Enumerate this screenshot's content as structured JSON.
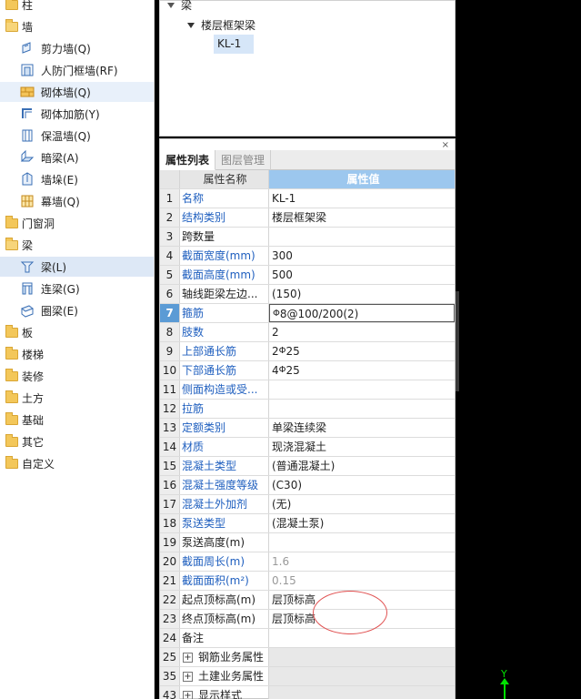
{
  "left_tree": [
    {
      "label": "柱",
      "kind": "folder"
    },
    {
      "label": "墙",
      "kind": "folder-open"
    },
    {
      "label": "剪力墙(Q)",
      "kind": "sub",
      "icon": "shear-wall-icon"
    },
    {
      "label": "人防门框墙(RF)",
      "kind": "sub",
      "icon": "door-frame-wall-icon"
    },
    {
      "label": "砌体墙(Q)",
      "kind": "sub",
      "icon": "masonry-wall-icon",
      "state": "hover"
    },
    {
      "label": "砌体加筋(Y)",
      "kind": "sub",
      "icon": "masonry-rebar-icon"
    },
    {
      "label": "保温墙(Q)",
      "kind": "sub",
      "icon": "insulation-wall-icon"
    },
    {
      "label": "暗梁(A)",
      "kind": "sub",
      "icon": "hidden-beam-icon"
    },
    {
      "label": "墙垛(E)",
      "kind": "sub",
      "icon": "wall-pier-icon"
    },
    {
      "label": "幕墙(Q)",
      "kind": "sub",
      "icon": "curtain-wall-icon"
    },
    {
      "label": "门窗洞",
      "kind": "folder"
    },
    {
      "label": "梁",
      "kind": "folder-open"
    },
    {
      "label": "梁(L)",
      "kind": "sub",
      "icon": "beam-icon",
      "state": "selected"
    },
    {
      "label": "连梁(G)",
      "kind": "sub",
      "icon": "coupling-beam-icon"
    },
    {
      "label": "圈梁(E)",
      "kind": "sub",
      "icon": "ring-beam-icon"
    },
    {
      "label": "板",
      "kind": "folder"
    },
    {
      "label": "楼梯",
      "kind": "folder"
    },
    {
      "label": "装修",
      "kind": "folder"
    },
    {
      "label": "土方",
      "kind": "folder"
    },
    {
      "label": "基础",
      "kind": "folder"
    },
    {
      "label": "其它",
      "kind": "folder"
    },
    {
      "label": "自定义",
      "kind": "folder"
    }
  ],
  "component_tree": {
    "root": "梁",
    "child": "楼层框架梁",
    "selected": "KL-1"
  },
  "property_panel": {
    "close": "×",
    "tabs": [
      "属性列表",
      "图层管理"
    ],
    "header": {
      "name": "属性名称",
      "value": "属性值"
    },
    "rows": [
      {
        "no": "1",
        "name": "名称",
        "value": "KL-1",
        "blue": true
      },
      {
        "no": "2",
        "name": "结构类别",
        "value": "楼层框架梁",
        "blue": true
      },
      {
        "no": "3",
        "name": "跨数量",
        "value": "",
        "blue": false
      },
      {
        "no": "4",
        "name": "截面宽度(mm)",
        "value": "300",
        "blue": true
      },
      {
        "no": "5",
        "name": "截面高度(mm)",
        "value": "500",
        "blue": true
      },
      {
        "no": "6",
        "name": "轴线距梁左边...",
        "value": "(150)",
        "blue": false
      },
      {
        "no": "7",
        "name": "箍筋",
        "value": "8@100/200(2)",
        "blue": true,
        "selected": true,
        "rebar": true
      },
      {
        "no": "8",
        "name": "肢数",
        "value": "2",
        "blue": true
      },
      {
        "no": "9",
        "name": "上部通长筋",
        "value": "2",
        "blue": true,
        "rebar_suffix": "25"
      },
      {
        "no": "10",
        "name": "下部通长筋",
        "value": "4",
        "blue": true,
        "rebar_suffix": "25"
      },
      {
        "no": "11",
        "name": "侧面构造或受...",
        "value": "",
        "blue": true
      },
      {
        "no": "12",
        "name": "拉筋",
        "value": "",
        "blue": true
      },
      {
        "no": "13",
        "name": "定额类别",
        "value": "单梁连续梁",
        "blue": true
      },
      {
        "no": "14",
        "name": "材质",
        "value": "现浇混凝土",
        "blue": true
      },
      {
        "no": "15",
        "name": "混凝土类型",
        "value": "(普通混凝土)",
        "blue": true
      },
      {
        "no": "16",
        "name": "混凝土强度等级",
        "value": "(C30)",
        "blue": true
      },
      {
        "no": "17",
        "name": "混凝土外加剂",
        "value": "(无)",
        "blue": true
      },
      {
        "no": "18",
        "name": "泵送类型",
        "value": "(混凝土泵)",
        "blue": true
      },
      {
        "no": "19",
        "name": "泵送高度(m)",
        "value": "",
        "blue": false
      },
      {
        "no": "20",
        "name": "截面周长(m)",
        "value": "1.6",
        "blue": true,
        "readonly": true
      },
      {
        "no": "21",
        "name": "截面面积(m²)",
        "value": "0.15",
        "blue": true,
        "readonly": true
      },
      {
        "no": "22",
        "name": "起点顶标高(m)",
        "value": "层顶标高",
        "blue": false
      },
      {
        "no": "23",
        "name": "终点顶标高(m)",
        "value": "层顶标高",
        "blue": false
      },
      {
        "no": "24",
        "name": "备注",
        "value": "",
        "blue": false
      },
      {
        "no": "25",
        "name": "钢筋业务属性",
        "value": "",
        "group": true
      },
      {
        "no": "35",
        "name": "土建业务属性",
        "value": "",
        "group": true
      },
      {
        "no": "43",
        "name": "显示样式",
        "value": "",
        "group": true
      }
    ]
  },
  "axis_label": "Y",
  "colors": {
    "accent_blue": "#1f5fbf",
    "header_value_bg": "#9cc7ee",
    "selected_row_no": "#5b9bd5",
    "annotation": "#e05050",
    "axis_green": "#00e000"
  }
}
